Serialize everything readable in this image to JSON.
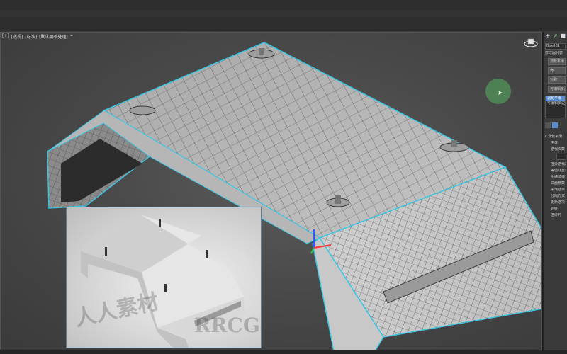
{
  "viewport": {
    "labels": [
      "[+]",
      "[透视]",
      "[标准]",
      "[默认明暗处理]",
      "⏷"
    ]
  },
  "command_panel": {
    "tabs": [
      "+",
      "↗",
      "■"
    ],
    "object_name": "Box001",
    "modifier_list": "修改器列表",
    "buttons": [
      "涡轮平滑",
      "壳",
      "对称",
      "可编辑多边形"
    ],
    "stack": [
      "涡轮平滑",
      "可编辑多边形"
    ],
    "rollout_title": "▾ 涡轮平滑",
    "rollout_sub": "主体",
    "items": [
      "迭代次数",
      "渲染迭代次数",
      "等值线显示",
      "明确法线",
      "曲面参数",
      "平滑结果",
      "分隔方式",
      "更新选项",
      "始终",
      "渲染时"
    ]
  },
  "preview": {
    "watermark_1": "人人素材",
    "watermark_2": "RRCG"
  },
  "colors": {
    "selection_outline": "#39c8e6",
    "mesh_face": "#bdbdbd",
    "mesh_edge": "#3a3a3a",
    "cursor": "#50965a"
  }
}
